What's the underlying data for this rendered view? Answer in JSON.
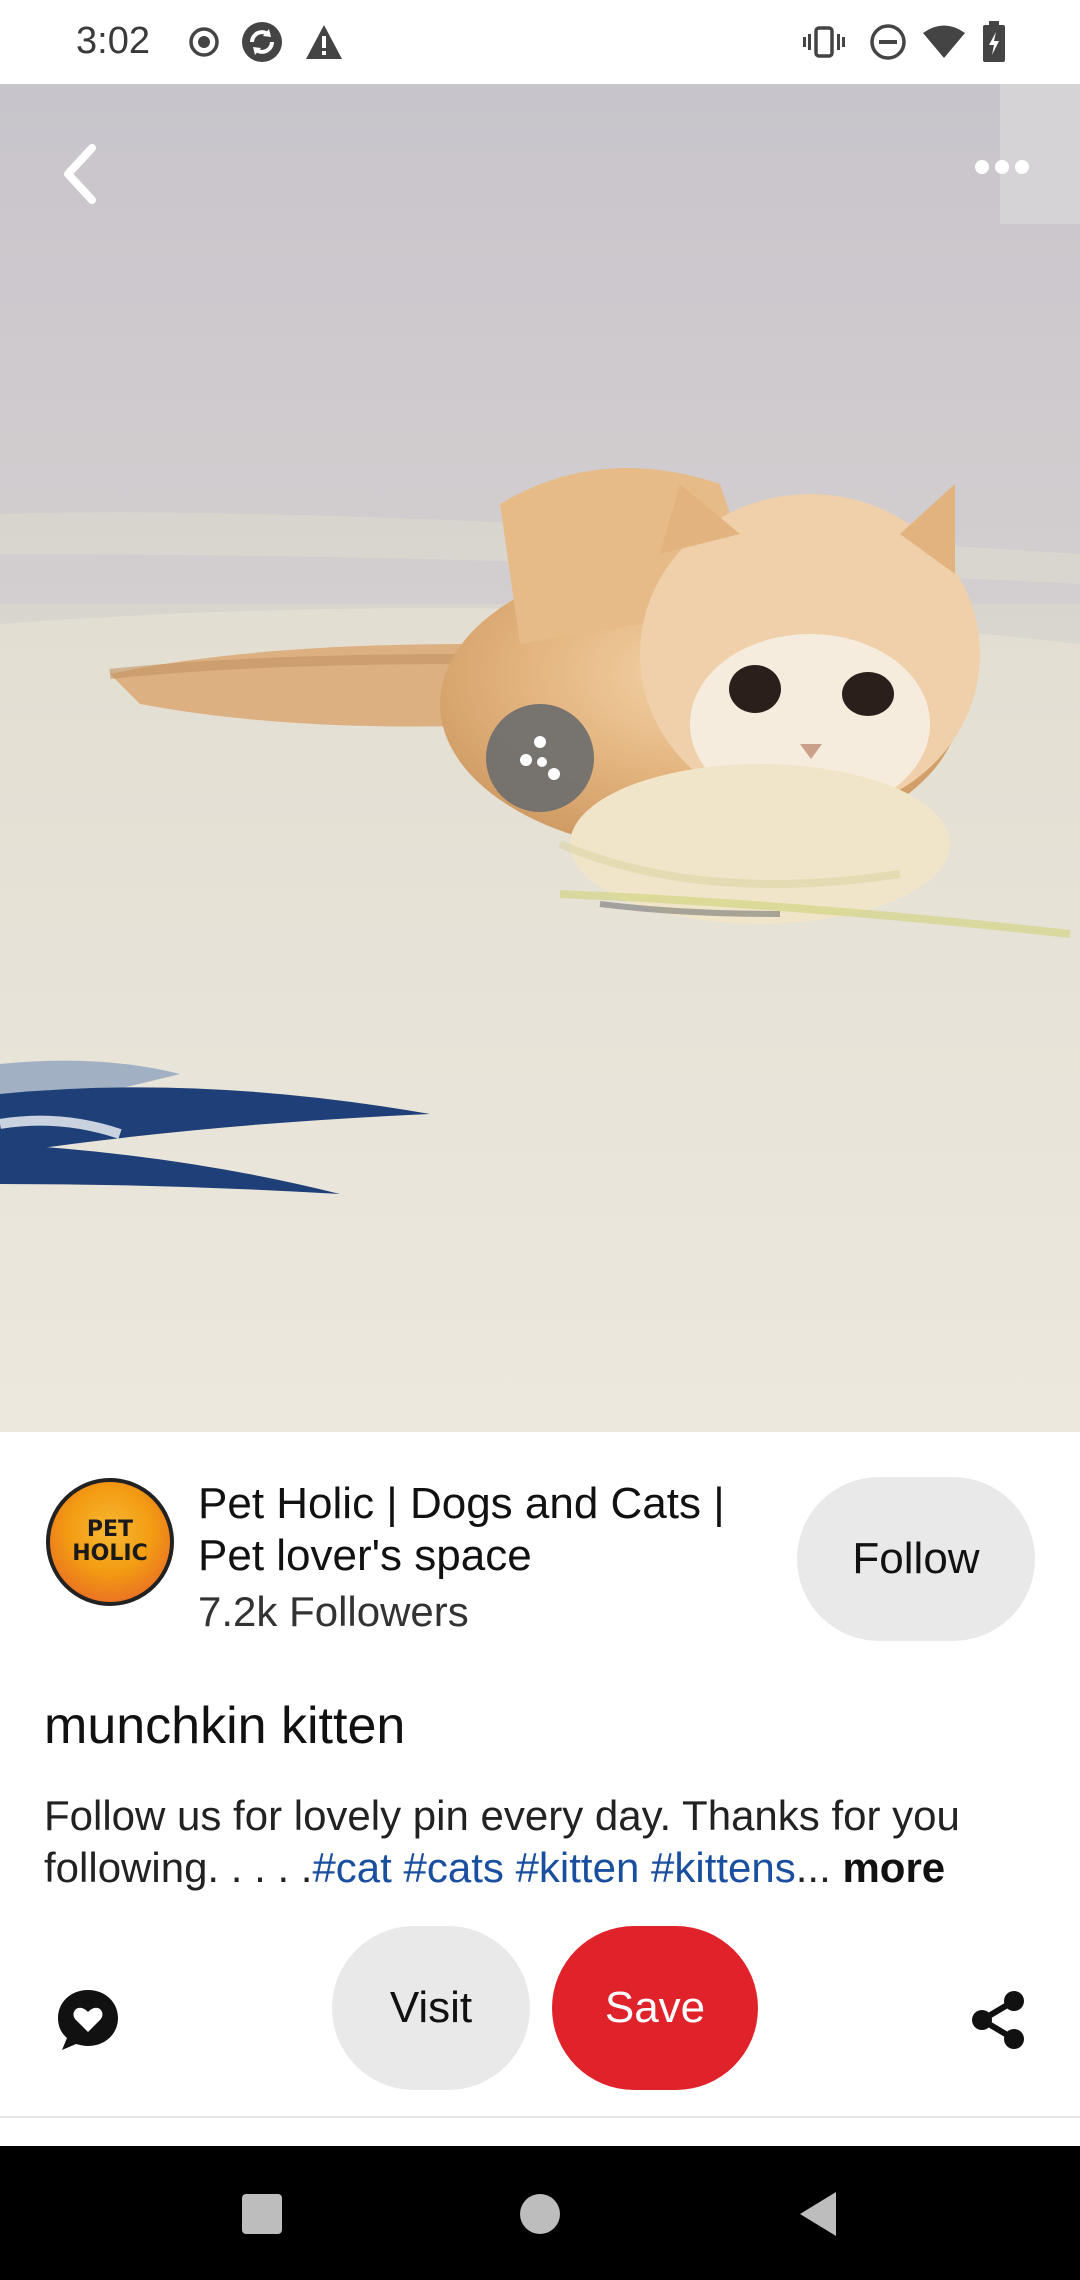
{
  "status_bar": {
    "time": "3:02",
    "left_icons": [
      "record-icon",
      "sync-icon",
      "warning-icon"
    ],
    "right_icons": [
      "vibrate-icon",
      "do-not-disturb-icon",
      "wifi-icon",
      "battery-charging-icon"
    ]
  },
  "media": {
    "back_icon": "chevron-left-icon",
    "more_icon": "more-horizontal-icon",
    "lens_icon": "visual-search-icon"
  },
  "creator": {
    "avatar_line1": "PET",
    "avatar_line2": "HOLIC",
    "name": "Pet Holic | Dogs and Cats | Pet lover's space",
    "followers": "7.2k Followers",
    "follow_label": "Follow"
  },
  "pin": {
    "title": "munchkin kitten",
    "description_text": "Follow us for lovely pin every day. Thanks for you following. . . . .",
    "hashtags": [
      "#cat",
      "#cats",
      "#kitten",
      "#kittens"
    ],
    "ellipsis": "...",
    "more_label": "more"
  },
  "actions": {
    "comment_icon": "comment-heart-icon",
    "visit_label": "Visit",
    "save_label": "Save",
    "share_icon": "share-icon"
  },
  "colors": {
    "save_red": "#e0222b",
    "pill_gray": "#e9e9e9",
    "hashtag_blue": "#1a4fa0"
  },
  "nav_bar": {
    "icons": [
      "recents-square-icon",
      "home-circle-icon",
      "back-triangle-icon"
    ]
  }
}
